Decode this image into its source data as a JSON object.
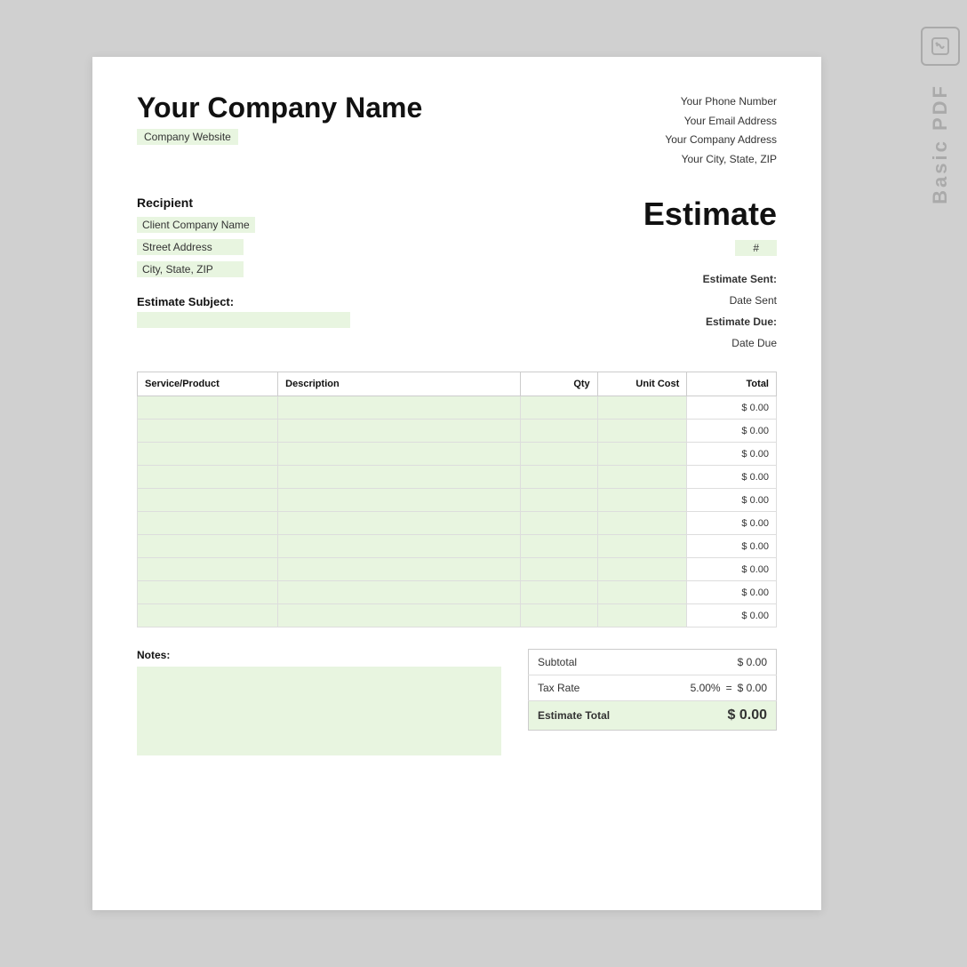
{
  "app": {
    "name": "Basic PDF",
    "icon": "🔗"
  },
  "document": {
    "company": {
      "name": "Your Company Name",
      "website": "Company Website",
      "phone": "Your Phone Number",
      "email": "Your Email Address",
      "address": "Your Company Address",
      "cityStateZip": "Your City, State, ZIP"
    },
    "recipient": {
      "sectionLabel": "Recipient",
      "companyName": "Client Company Name",
      "street": "Street Address",
      "cityStateZip": "City, State, ZIP"
    },
    "estimateSubjectLabel": "Estimate Subject:",
    "estimate": {
      "title": "Estimate",
      "numberSymbol": "#",
      "sentLabel": "Estimate Sent:",
      "sentValue": "Date Sent",
      "dueLabel": "Estimate Due:",
      "dueValue": "Date Due"
    },
    "table": {
      "headers": [
        "Service/Product",
        "Description",
        "Qty",
        "Unit Cost",
        "Total"
      ],
      "rows": [
        {
          "total": "$ 0.00"
        },
        {
          "total": "$ 0.00"
        },
        {
          "total": "$ 0.00"
        },
        {
          "total": "$ 0.00"
        },
        {
          "total": "$ 0.00"
        },
        {
          "total": "$ 0.00"
        },
        {
          "total": "$ 0.00"
        },
        {
          "total": "$ 0.00"
        },
        {
          "total": "$ 0.00"
        },
        {
          "total": "$ 0.00"
        }
      ]
    },
    "notes": {
      "label": "Notes:"
    },
    "totals": {
      "subtotalLabel": "Subtotal",
      "subtotalValue": "$ 0.00",
      "taxRateLabel": "Tax Rate",
      "taxRatePercent": "5.00%",
      "taxRateEquals": "=",
      "taxRateValue": "$ 0.00",
      "totalLabel": "Estimate Total",
      "totalValue": "$ 0.00"
    }
  }
}
